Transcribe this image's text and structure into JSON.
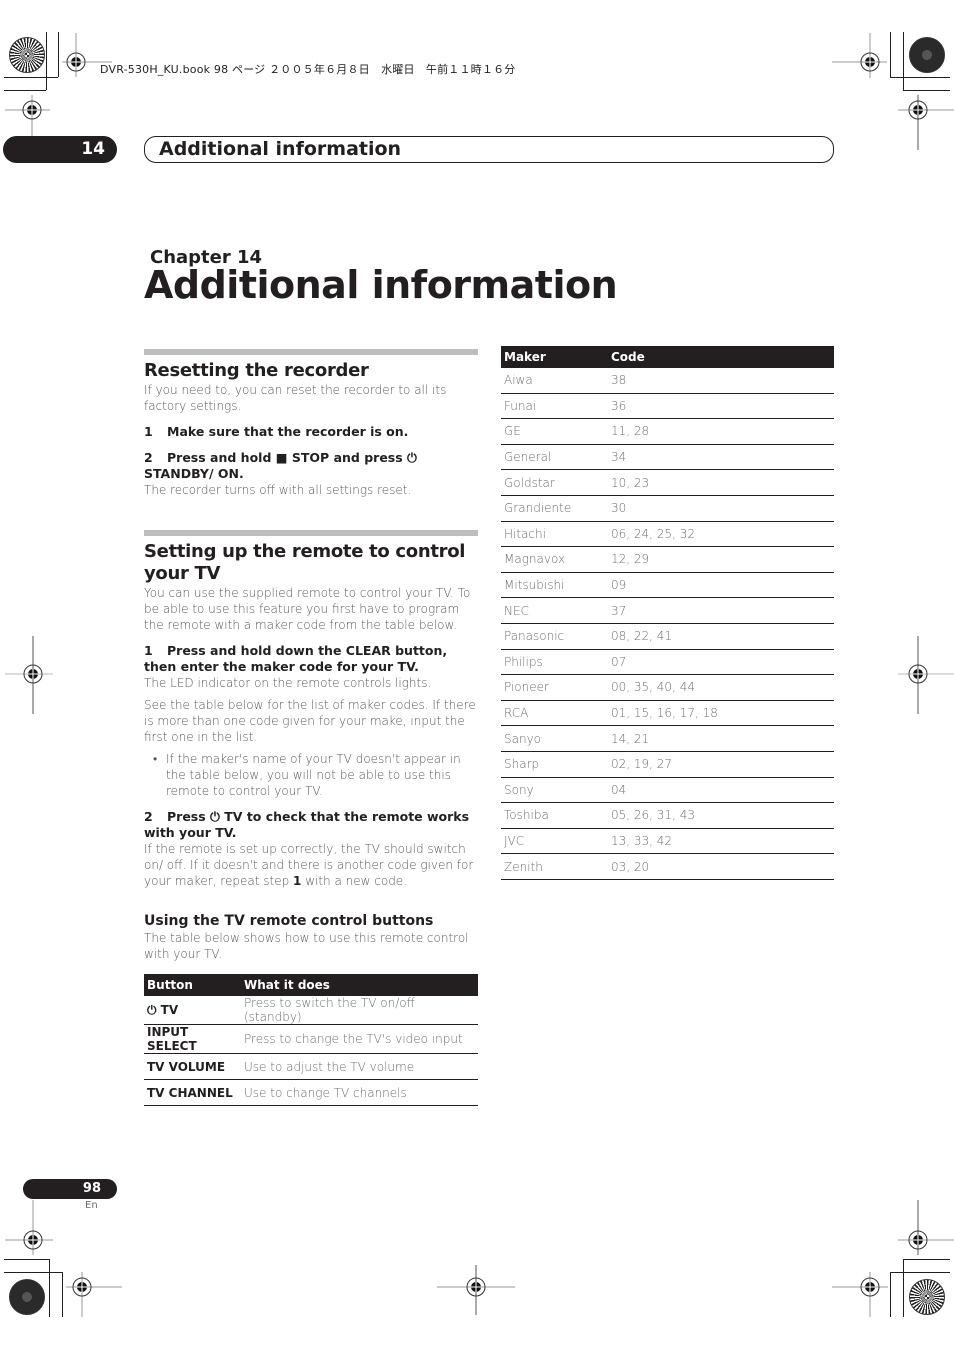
{
  "print_meta": "DVR-530H_KU.book  98 ページ  ２００５年６月８日　水曜日　午前１１時１６分",
  "running_header": {
    "chapter_number": "14",
    "title": "Additional information"
  },
  "chapter": {
    "label": "Chapter 14",
    "title": "Additional information"
  },
  "sections": {
    "reset": {
      "heading": "Resetting the recorder",
      "intro": "If you need to, you can reset the recorder to all its factory settings.",
      "step1_num": "1",
      "step1": "Make sure that the recorder is on.",
      "step2_num": "2",
      "step2": "Press and hold ■ STOP and press ⏻ STANDBY/ ON.",
      "step2_result": "The recorder turns off with all settings reset."
    },
    "remote": {
      "heading": "Setting up the remote to control your TV",
      "intro": "You can use the supplied remote to control your TV. To be able to use this feature you first have to program the remote with a maker code from the table below.",
      "step1_num": "1",
      "step1": "Press and hold down the CLEAR button, then enter the maker code for your TV.",
      "step1_result": "The LED indicator on the remote controls lights.",
      "step1_note": "See the table below for the list of maker codes. If there is more than one code given for your make, input the first one in the list.",
      "bullet": "If the maker's name of your TV doesn't appear in the table below, you will not be able to use this remote to control your TV.",
      "step2_num": "2",
      "step2": "Press ⏻ TV to check that the remote works with your TV.",
      "step2_result_a": "If the remote is set up correctly, the TV should switch on/ off. If it doesn't and there is another code given for your maker, repeat step ",
      "step2_result_bold": "1",
      "step2_result_b": " with a new code."
    },
    "buttons": {
      "heading": "Using the TV remote control buttons",
      "intro": "The table below shows how to use this remote control with your TV.",
      "table": {
        "headers": [
          "Button",
          "What it does"
        ],
        "rows": [
          {
            "button": "⏻ TV",
            "desc": "Press to switch the TV on/off (standby)"
          },
          {
            "button": "INPUT SELECT",
            "desc": "Press to change the TV's video input"
          },
          {
            "button": "TV VOLUME",
            "desc": "Use to adjust the TV volume"
          },
          {
            "button": "TV CHANNEL",
            "desc": "Use to change TV channels"
          }
        ]
      }
    }
  },
  "maker_table": {
    "headers": [
      "Maker",
      "Code"
    ],
    "rows": [
      {
        "maker": "Aiwa",
        "code": "38"
      },
      {
        "maker": "Funai",
        "code": "36"
      },
      {
        "maker": "GE",
        "code": "11, 28"
      },
      {
        "maker": "General",
        "code": "34"
      },
      {
        "maker": "Goldstar",
        "code": "10, 23"
      },
      {
        "maker": "Grandiente",
        "code": "30"
      },
      {
        "maker": "Hitachi",
        "code": "06, 24, 25, 32"
      },
      {
        "maker": "Magnavox",
        "code": "12, 29"
      },
      {
        "maker": "Mitsubishi",
        "code": "09"
      },
      {
        "maker": "NEC",
        "code": "37"
      },
      {
        "maker": "Panasonic",
        "code": "08, 22, 41"
      },
      {
        "maker": "Philips",
        "code": "07"
      },
      {
        "maker": "Pioneer",
        "code": "00, 35, 40, 44"
      },
      {
        "maker": "RCA",
        "code": "01, 15, 16, 17, 18"
      },
      {
        "maker": "Sanyo",
        "code": "14, 21"
      },
      {
        "maker": "Sharp",
        "code": "02, 19, 27"
      },
      {
        "maker": "Sony",
        "code": "04"
      },
      {
        "maker": "Toshiba",
        "code": "05, 26, 31, 43"
      },
      {
        "maker": "JVC",
        "code": "13, 33, 42"
      },
      {
        "maker": "Zenith",
        "code": "03, 20"
      }
    ]
  },
  "footer": {
    "page_number": "98",
    "language": "En"
  }
}
